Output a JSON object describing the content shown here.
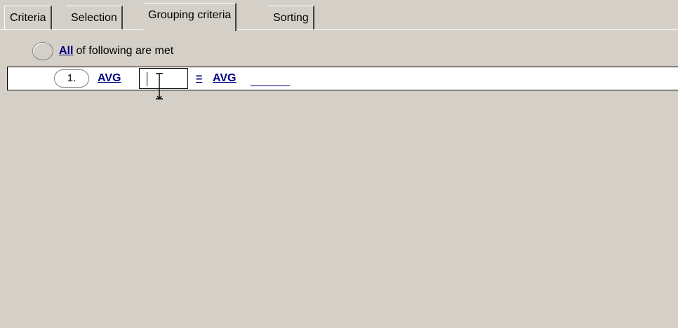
{
  "tabs": [
    {
      "label": "Criteria",
      "active": false
    },
    {
      "label": "Selection",
      "active": false
    },
    {
      "label": "Grouping criteria",
      "active": true
    },
    {
      "label": "Sorting",
      "active": false
    }
  ],
  "group_header": {
    "quantifier": "All",
    "suffix": "of following are met"
  },
  "condition": {
    "number": "1.",
    "left_function": "AVG",
    "value": "",
    "operator": "=",
    "right_function": "AVG",
    "right_value": ""
  },
  "colors": {
    "background": "#d4d0c8",
    "link": "#000080",
    "row_background": "#ffffff"
  },
  "icons": {
    "cursor": "ibeam-cursor-icon",
    "group_toggle": "circle-toggle-icon"
  }
}
